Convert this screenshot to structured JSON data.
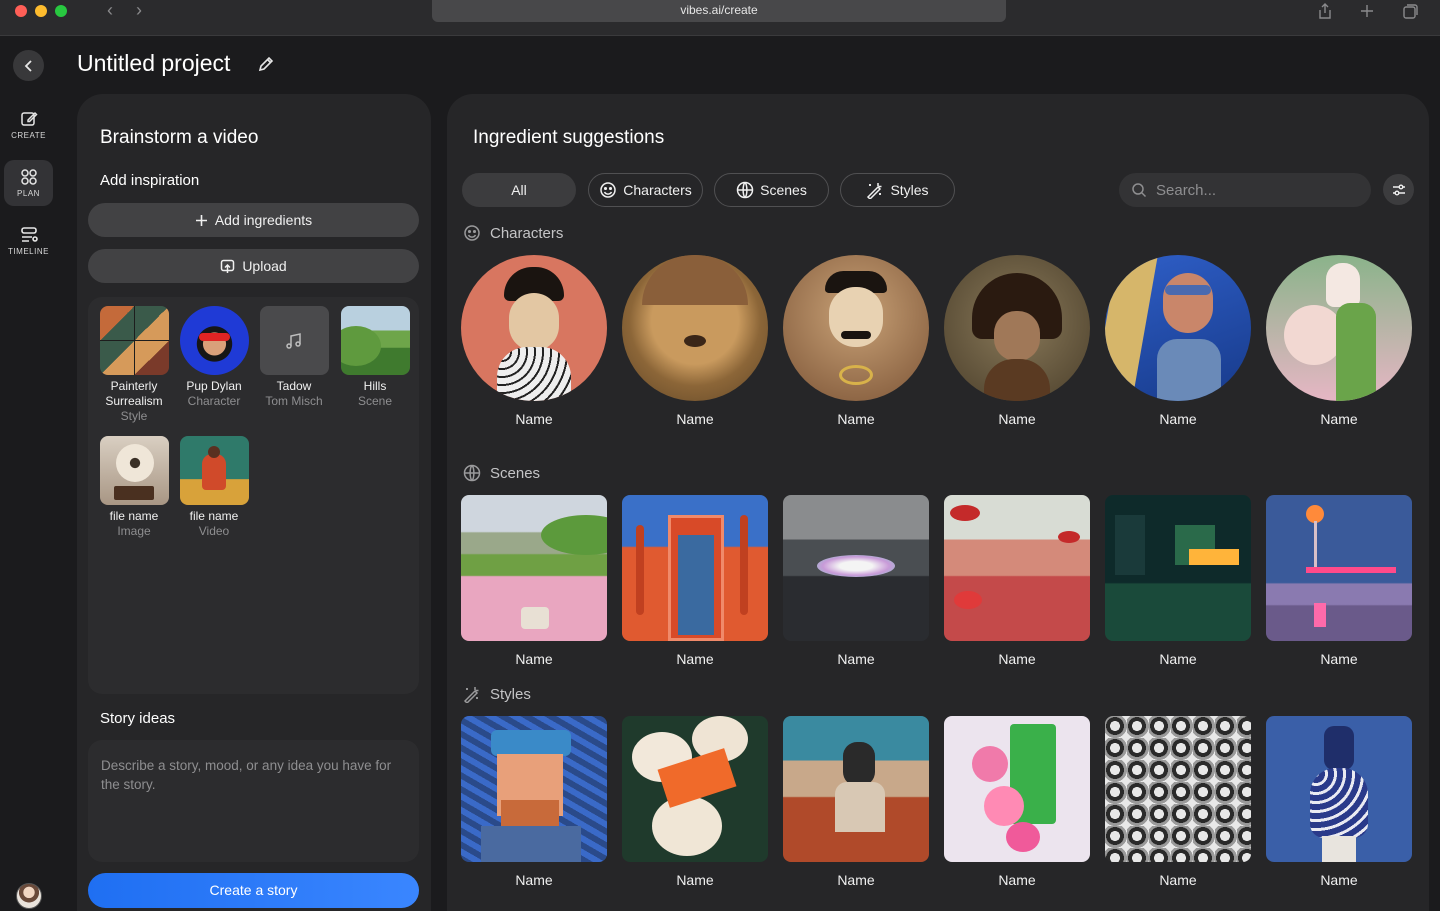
{
  "browser": {
    "url": "vibes.ai/create"
  },
  "rail": {
    "items": [
      {
        "label": "CREATE"
      },
      {
        "label": "PLAN"
      },
      {
        "label": "TIMELINE"
      }
    ]
  },
  "project": {
    "title": "Untitled project"
  },
  "brainstorm": {
    "title": "Brainstorm a video",
    "add_inspiration": "Add inspiration",
    "add_ingredients_label": "Add ingredients",
    "upload_label": "Upload",
    "inspirations": [
      {
        "name": "Painterly Surrealism",
        "type": "Style",
        "icon": "image-thumb"
      },
      {
        "name": "Pup Dylan",
        "type": "Character",
        "icon": "portrait-thumb"
      },
      {
        "name": "Tadow",
        "type": "Tom Misch",
        "icon": "music-note-icon"
      },
      {
        "name": "Hills",
        "type": "Scene",
        "icon": "landscape-thumb"
      },
      {
        "name": "file name",
        "type": "Image",
        "icon": "gramophone-thumb"
      },
      {
        "name": "file name",
        "type": "Video",
        "icon": "video-thumb"
      }
    ],
    "story_ideas_title": "Story ideas",
    "story_placeholder": "Describe a story, mood, or any idea you have for the story.",
    "create_button": "Create a story"
  },
  "suggestions": {
    "title": "Ingredient suggestions",
    "filters": [
      {
        "label": "All",
        "icon": ""
      },
      {
        "label": "Characters",
        "icon": "smiley-icon"
      },
      {
        "label": "Scenes",
        "icon": "globe-icon"
      },
      {
        "label": "Styles",
        "icon": "magic-wand-icon"
      }
    ],
    "search_placeholder": "Search...",
    "sections": [
      {
        "title": "Characters",
        "icon": "smiley-icon",
        "items": [
          "Name",
          "Name",
          "Name",
          "Name",
          "Name",
          "Name"
        ]
      },
      {
        "title": "Scenes",
        "icon": "globe-icon",
        "items": [
          "Name",
          "Name",
          "Name",
          "Name",
          "Name",
          "Name"
        ]
      },
      {
        "title": "Styles",
        "icon": "magic-wand-icon",
        "items": [
          "Name",
          "Name",
          "Name",
          "Name",
          "Name",
          "Name"
        ]
      }
    ]
  },
  "colors": {
    "accent": "#2f7cf6",
    "panel": "#262628",
    "background": "#1b1b1d"
  }
}
